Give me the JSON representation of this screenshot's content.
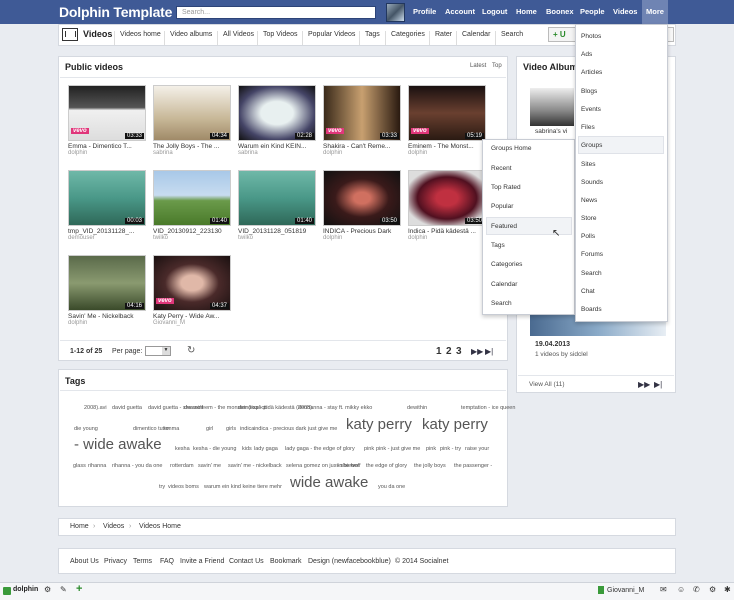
{
  "topbar": {
    "logo": "Dolphin Template",
    "search_placeholder": "Search...",
    "nav": [
      "Profile",
      "Account",
      "Logout",
      "Home",
      "Boonex",
      "People",
      "Videos"
    ],
    "more": "More"
  },
  "subbar": {
    "title": "Videos",
    "items": [
      "Videos home",
      "Video albums",
      "All Videos",
      "Top Videos",
      "Popular Videos",
      "Tags",
      "Categories",
      "Rater",
      "Calendar",
      "Search"
    ],
    "upload": "+ U"
  },
  "public_videos": {
    "title": "Public videos",
    "tab_latest": "Latest",
    "tab_top": "Top",
    "videos": [
      {
        "title": "Emma - Dimentico T...",
        "author": "dolphin",
        "duration": "03:33",
        "vevo": true
      },
      {
        "title": "The Jolly Boys - The ...",
        "author": "sabrina",
        "duration": "04:34",
        "vevo": false
      },
      {
        "title": "Warum ein Kind KEIN...",
        "author": "sabrina",
        "duration": "02:28",
        "vevo": false
      },
      {
        "title": "Shakira - Can't Reme...",
        "author": "dolphin",
        "duration": "03:33",
        "vevo": true
      },
      {
        "title": "Eminem - The Monst...",
        "author": "dolphin",
        "duration": "05:19",
        "vevo": true
      },
      {
        "title": "tmp_VID_20131128_...",
        "author": "demouser",
        "duration": "00:03",
        "vevo": false
      },
      {
        "title": "VID_20130912_223130",
        "author": "twilko",
        "duration": "01:40",
        "vevo": false
      },
      {
        "title": "VID_20131128_051819",
        "author": "twilko",
        "duration": "01:40",
        "vevo": false
      },
      {
        "title": "INDICA - Precious Dark",
        "author": "dolphin",
        "duration": "03:50",
        "vevo": false
      },
      {
        "title": "Indica - Pidä kädestä ...",
        "author": "dolphin",
        "duration": "03:50",
        "vevo": false
      },
      {
        "title": "Savin' Me - Nickelback",
        "author": "dolphin",
        "duration": "04:16",
        "vevo": false
      },
      {
        "title": "Katy Perry - Wide Aw...",
        "author": "Giovanni_M",
        "duration": "04:37",
        "vevo": true
      }
    ],
    "pager": {
      "range": "1-12 of 25",
      "per_page_label": "Per page:",
      "pages": [
        "1",
        "2",
        "3"
      ]
    }
  },
  "tags": {
    "title": "Tags",
    "list": [
      "2008).avi",
      "david guetta",
      "david guetta - she wolf",
      "deamineem - the monster (explicit",
      "deindica - pidä kädestä (2008)",
      "denhanna - stay ft. mikky ekko",
      "dewithin",
      "temptation - ice queen",
      "die young",
      "dimentico tutto",
      "emma",
      "girl",
      "girls",
      "indica",
      "indica - precious dark",
      "just give me",
      "katy perry",
      "katy perry",
      "- wide awake",
      "kesha",
      "kesha - die young",
      "kids",
      "lady gaga",
      "lady gaga - the edge of glory",
      "pink",
      "pink - just give me",
      "pink",
      "pink - try",
      "raise your",
      "glass",
      "rihanna",
      "rihanna - you da one",
      "rotterdam",
      "savin' me",
      "savin' me - nickelback",
      "selena gomez on justin bieber",
      "- she wolf",
      "the edge of glory",
      "the jolly boys",
      "the passenger -",
      "try",
      "videos boms",
      "warum ein kind keine tiere mehr",
      "wide awake",
      "you da one"
    ]
  },
  "video_albums": {
    "title": "Video Albums",
    "album_label": "sabrina's vi",
    "date": "19.04.2013",
    "subtitle": "1 videos by sidclel",
    "view_all": "View All (11)"
  },
  "groups_menu": [
    "Groups Home",
    "Recent",
    "Top Rated",
    "Popular",
    "Featured",
    "Tags",
    "Categories",
    "Calendar",
    "Search"
  ],
  "more_menu": [
    "Photos",
    "Ads",
    "Articles",
    "Blogs",
    "Events",
    "Files",
    "Groups",
    "Sites",
    "Sounds",
    "News",
    "Store",
    "Polls",
    "Forums",
    "Search",
    "Chat",
    "Boards"
  ],
  "breadcrumb": [
    "Home",
    "Videos",
    "Videos Home"
  ],
  "footer": {
    "links": [
      "About Us",
      "Privacy",
      "Terms",
      "FAQ",
      "Invite a Friend",
      "Contact Us",
      "Bookmark"
    ],
    "design": "Design (newfacebookblue)",
    "copyright": "© 2014 Socialnet"
  },
  "bottombar": {
    "label": "dolphin",
    "user": "Giovanni_M"
  }
}
